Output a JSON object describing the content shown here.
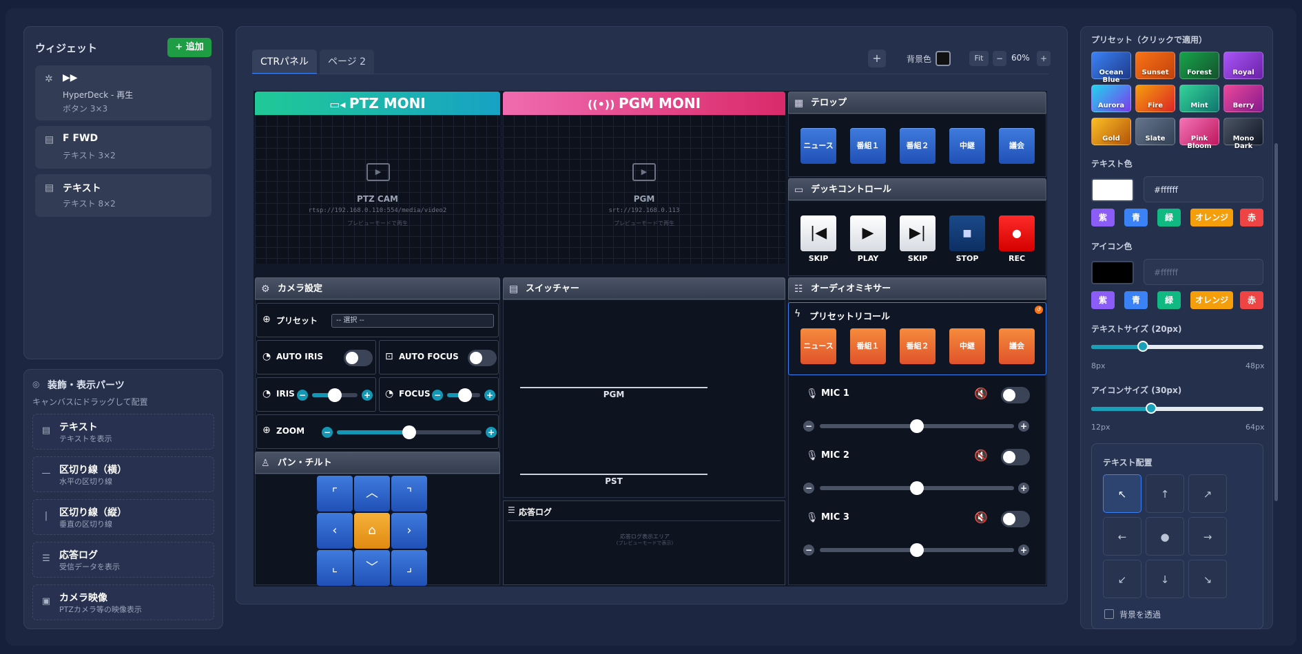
{
  "widgets": {
    "title": "ウィジェット",
    "add_label": "+ 追加",
    "items": [
      {
        "name": "▶▶",
        "sub": "HyperDeck - 再生",
        "meta": "ボタン  3×3"
      },
      {
        "name": "F FWD",
        "sub": "テキスト  3×2"
      },
      {
        "name": "テキスト",
        "sub": "テキスト  8×2"
      }
    ]
  },
  "decor": {
    "title": "装飾・表示パーツ",
    "subtitle": "キャンバスにドラッグして配置",
    "items": [
      {
        "name": "テキスト",
        "sub": "テキストを表示"
      },
      {
        "name": "区切り線（横）",
        "sub": "水平の区切り線"
      },
      {
        "name": "区切り線（縦）",
        "sub": "垂直の区切り線"
      },
      {
        "name": "応答ログ",
        "sub": "受信データを表示"
      },
      {
        "name": "カメラ映像",
        "sub": "PTZカメラ等の映像表示"
      }
    ]
  },
  "toolbar": {
    "tabs": [
      "CTRパネル",
      "ページ 2"
    ],
    "add": "+",
    "bg_label": "背景色",
    "fit": "Fit",
    "minus": "−",
    "zoom": "60%",
    "plus": "+"
  },
  "monitors": {
    "ptz": {
      "header": "PTZ MONI",
      "title": "PTZ CAM",
      "url": "rtsp://192.168.0.110:554/media/video2",
      "note": "プレビューモードで再生"
    },
    "pgm": {
      "header": "PGM MONI",
      "title": "PGM",
      "url": "srt://192.168.0.113",
      "note": "プレビューモードで再生"
    }
  },
  "telop": {
    "title": "テロップ",
    "buttons": [
      "ニュース",
      "番組１",
      "番組２",
      "中継",
      "議会"
    ]
  },
  "deck": {
    "title": "デッキコントロール",
    "buttons": [
      "SKIP",
      "PLAY",
      "SKIP",
      "STOP",
      "REC"
    ]
  },
  "camera": {
    "title": "カメラ設定",
    "preset_label": "プリセット",
    "preset_placeholder": "-- 選択 --",
    "auto_iris": "AUTO IRIS",
    "auto_focus": "AUTO FOCUS",
    "iris": "IRIS",
    "focus": "FOCUS",
    "zoom": "ZOOM",
    "iris_value": 0.5,
    "focus_value": 0.55,
    "zoom_value": 0.5
  },
  "pantilt": {
    "title": "パン・チルト"
  },
  "switcher": {
    "title": "スイッチャー",
    "pgm": "PGM",
    "pst": "PST"
  },
  "log": {
    "title": "応答ログ",
    "area": "応答ログ表示エリア",
    "note": "(プレビューモードで表示)"
  },
  "audio": {
    "title": "オーディオミキサー",
    "recall_title": "プリセットリコール",
    "recall_buttons": [
      "ニュース",
      "番組１",
      "番組２",
      "中継",
      "議会"
    ],
    "mics": [
      {
        "name": "MIC 1",
        "level": 0.5
      },
      {
        "name": "MIC 2",
        "level": 0.5
      },
      {
        "name": "MIC 3",
        "level": 0.5
      }
    ]
  },
  "props": {
    "preset_title": "プリセット（クリックで適用）",
    "presets": [
      "Ocean Blue",
      "Sunset",
      "Forest",
      "Royal",
      "Aurora",
      "Fire",
      "Mint",
      "Berry",
      "Gold",
      "Slate",
      "Pink Bloom",
      "Mono Dark"
    ],
    "text_color_label": "テキスト色",
    "text_color_value": "#ffffff",
    "chips": [
      "紫",
      "青",
      "緑",
      "オレンジ",
      "赤"
    ],
    "icon_color_label": "アイコン色",
    "icon_color_placeholder": "#ffffff",
    "text_size_label": "テキストサイズ (20px)",
    "text_size_min": "8px",
    "text_size_max": "48px",
    "text_size_value": 20,
    "icon_size_label": "アイコンサイズ (30px)",
    "icon_size_min": "12px",
    "icon_size_max": "64px",
    "icon_size_value": 30,
    "align_title": "テキスト配置",
    "bg_transparent": "背景を透過"
  },
  "colors": {
    "accent": "#1397b4",
    "add_green": "#1f9d45",
    "ptz_head": "#20c997",
    "pgm_head": "#e83e8c",
    "ptz_active": "#f0a020"
  }
}
